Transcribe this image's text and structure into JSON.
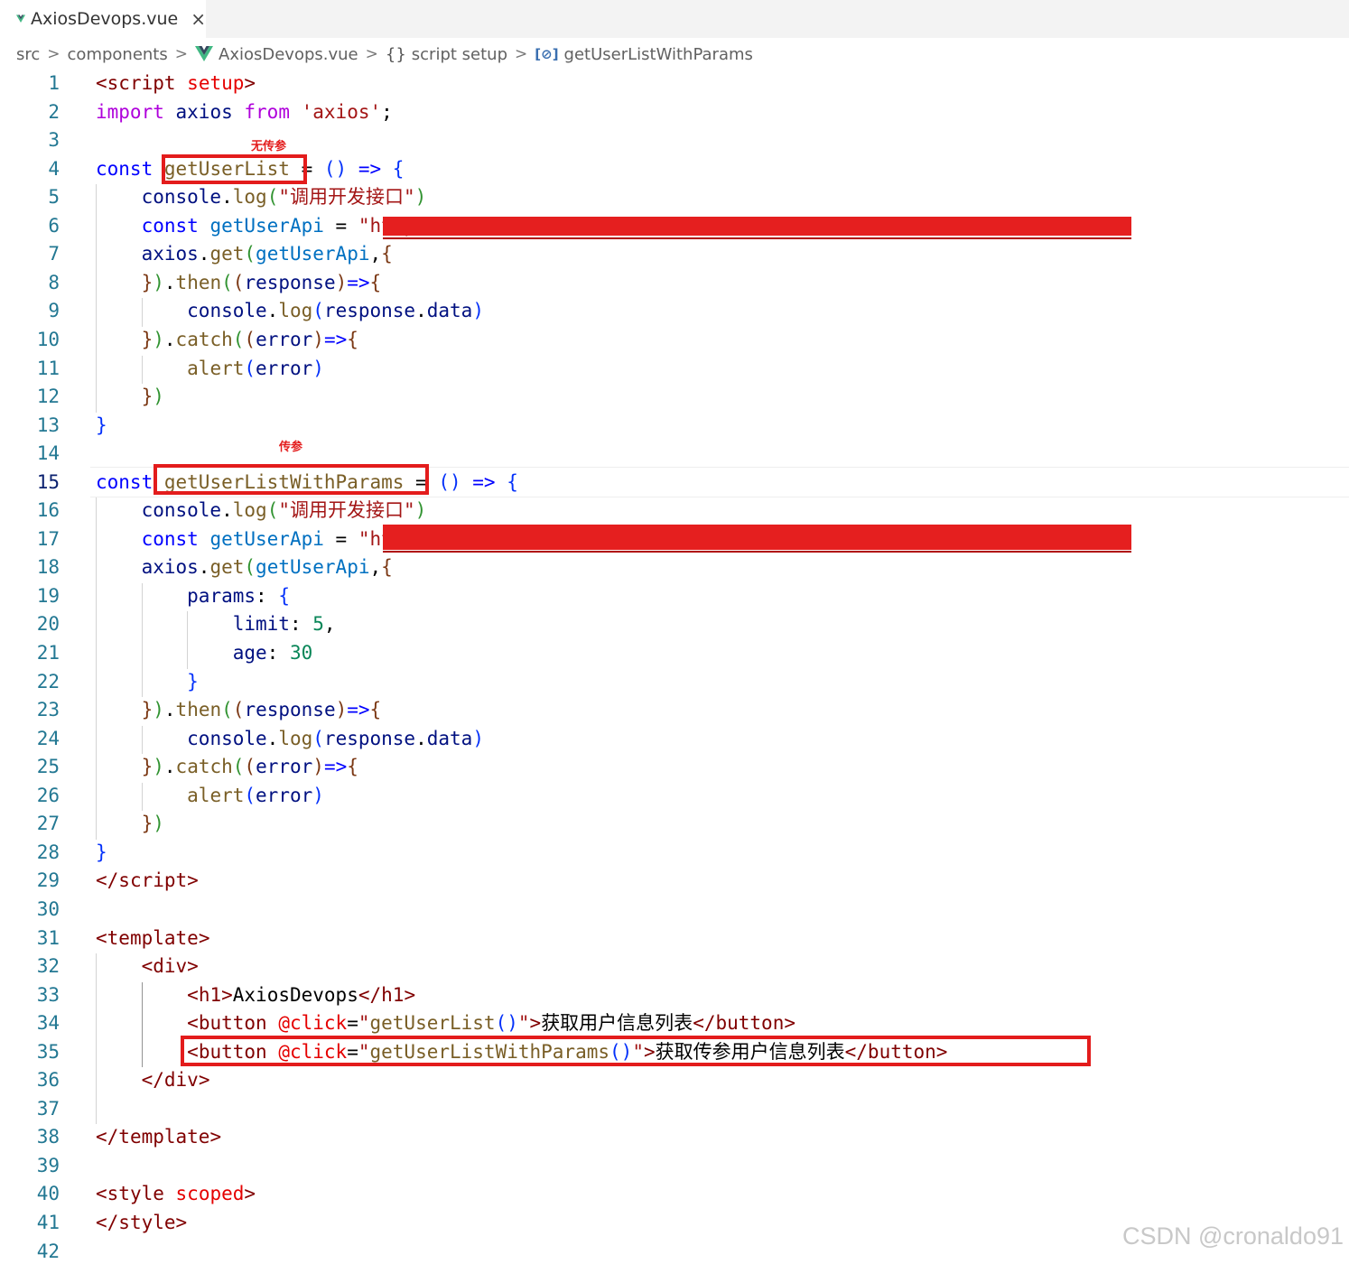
{
  "tab": {
    "title": "AxiosDevops.vue",
    "close_icon": "×"
  },
  "breadcrumb": {
    "src": "src",
    "components": "components",
    "file": "AxiosDevops.vue",
    "braces_icon": "{}",
    "section": "script setup",
    "var_icon": "[⊘]",
    "symbol": "getUserListWithParams",
    "sep": ">"
  },
  "annotations": {
    "no_params": "无传参",
    "with_params": "传参"
  },
  "editor": {
    "active_line": 15,
    "line_numbers": [
      "1",
      "2",
      "3",
      "4",
      "5",
      "6",
      "7",
      "8",
      "9",
      "10",
      "11",
      "12",
      "13",
      "14",
      "15",
      "16",
      "17",
      "18",
      "19",
      "20",
      "21",
      "22",
      "23",
      "24",
      "25",
      "26",
      "27",
      "28",
      "29",
      "30",
      "31",
      "32",
      "33",
      "34",
      "35",
      "36",
      "37",
      "38",
      "39",
      "40",
      "41",
      "42"
    ],
    "lines": [
      [
        [
          "ang",
          "<"
        ],
        [
          "tag",
          "script"
        ],
        [
          "pl",
          " "
        ],
        [
          "attr",
          "setup"
        ],
        [
          "ang",
          ">"
        ]
      ],
      [
        [
          "ctl",
          "import"
        ],
        [
          "pl",
          " "
        ],
        [
          "var",
          "axios"
        ],
        [
          "pl",
          " "
        ],
        [
          "ctl",
          "from"
        ],
        [
          "pl",
          " "
        ],
        [
          "str",
          "'axios'"
        ],
        [
          "pl",
          ";"
        ]
      ],
      [],
      [
        [
          "kw",
          "const"
        ],
        [
          "pl",
          " "
        ],
        [
          "fn",
          "getUserList"
        ],
        [
          "pl",
          " = "
        ],
        [
          "br1",
          "()"
        ],
        [
          "pl",
          " "
        ],
        [
          "kw",
          "=>"
        ],
        [
          "pl",
          " "
        ],
        [
          "br1",
          "{"
        ]
      ],
      [
        [
          "pl",
          "    "
        ],
        [
          "var",
          "console"
        ],
        [
          "pl",
          "."
        ],
        [
          "fn",
          "log"
        ],
        [
          "br2",
          "("
        ],
        [
          "str",
          "\"调用开发接口\""
        ],
        [
          "br2",
          ")"
        ]
      ],
      [
        [
          "pl",
          "    "
        ],
        [
          "kw",
          "const"
        ],
        [
          "pl",
          " "
        ],
        [
          "cst",
          "getUserApi"
        ],
        [
          "pl",
          " = "
        ],
        [
          "str",
          "\"https://xxxx.xxxx.xxxxxxxx.xxxxxx/xxxxxxx/xxxxxxx/xxxx\""
        ]
      ],
      [
        [
          "pl",
          "    "
        ],
        [
          "var",
          "axios"
        ],
        [
          "pl",
          "."
        ],
        [
          "fn",
          "get"
        ],
        [
          "br2",
          "("
        ],
        [
          "cst",
          "getUserApi"
        ],
        [
          "pl",
          ","
        ],
        [
          "br3",
          "{"
        ]
      ],
      [
        [
          "pl",
          "    "
        ],
        [
          "br3",
          "}"
        ],
        [
          "br2",
          ")"
        ],
        [
          "pl",
          "."
        ],
        [
          "fn",
          "then"
        ],
        [
          "br2",
          "("
        ],
        [
          "br3",
          "("
        ],
        [
          "var",
          "response"
        ],
        [
          "br3",
          ")"
        ],
        [
          "kw",
          "=>"
        ],
        [
          "br3",
          "{"
        ]
      ],
      [
        [
          "pl",
          "        "
        ],
        [
          "var",
          "console"
        ],
        [
          "pl",
          "."
        ],
        [
          "fn",
          "log"
        ],
        [
          "br1",
          "("
        ],
        [
          "var",
          "response"
        ],
        [
          "pl",
          "."
        ],
        [
          "var",
          "data"
        ],
        [
          "br1",
          ")"
        ]
      ],
      [
        [
          "pl",
          "    "
        ],
        [
          "br3",
          "}"
        ],
        [
          "br2",
          ")"
        ],
        [
          "pl",
          "."
        ],
        [
          "fn",
          "catch"
        ],
        [
          "br2",
          "("
        ],
        [
          "br3",
          "("
        ],
        [
          "var",
          "error"
        ],
        [
          "br3",
          ")"
        ],
        [
          "kw",
          "=>"
        ],
        [
          "br3",
          "{"
        ]
      ],
      [
        [
          "pl",
          "        "
        ],
        [
          "fn",
          "alert"
        ],
        [
          "br1",
          "("
        ],
        [
          "var",
          "error"
        ],
        [
          "br1",
          ")"
        ]
      ],
      [
        [
          "pl",
          "    "
        ],
        [
          "br3",
          "}"
        ],
        [
          "br2",
          ")"
        ]
      ],
      [
        [
          "br1",
          "}"
        ]
      ],
      [],
      [
        [
          "kw",
          "const"
        ],
        [
          "pl",
          " "
        ],
        [
          "fn",
          "getUserListWithParams"
        ],
        [
          "pl",
          " = "
        ],
        [
          "br1",
          "()"
        ],
        [
          "pl",
          " "
        ],
        [
          "kw",
          "=>"
        ],
        [
          "pl",
          " "
        ],
        [
          "br1",
          "{"
        ]
      ],
      [
        [
          "pl",
          "    "
        ],
        [
          "var",
          "console"
        ],
        [
          "pl",
          "."
        ],
        [
          "fn",
          "log"
        ],
        [
          "br2",
          "("
        ],
        [
          "str",
          "\"调用开发接口\""
        ],
        [
          "br2",
          ")"
        ]
      ],
      [
        [
          "pl",
          "    "
        ],
        [
          "kw",
          "const"
        ],
        [
          "pl",
          " "
        ],
        [
          "cst",
          "getUserApi"
        ],
        [
          "pl",
          " = "
        ],
        [
          "str",
          "\"https://xxxx.xxxx.xxxxxxxx.xxxxxx/xxxxxxx/xxxxxxx/xxxx\""
        ]
      ],
      [
        [
          "pl",
          "    "
        ],
        [
          "var",
          "axios"
        ],
        [
          "pl",
          "."
        ],
        [
          "fn",
          "get"
        ],
        [
          "br2",
          "("
        ],
        [
          "cst",
          "getUserApi"
        ],
        [
          "pl",
          ","
        ],
        [
          "br3",
          "{"
        ]
      ],
      [
        [
          "pl",
          "        "
        ],
        [
          "var",
          "params"
        ],
        [
          "pl",
          ": "
        ],
        [
          "br1",
          "{"
        ]
      ],
      [
        [
          "pl",
          "            "
        ],
        [
          "var",
          "limit"
        ],
        [
          "pl",
          ": "
        ],
        [
          "num",
          "5"
        ],
        [
          "pl",
          ","
        ]
      ],
      [
        [
          "pl",
          "            "
        ],
        [
          "var",
          "age"
        ],
        [
          "pl",
          ": "
        ],
        [
          "num",
          "30"
        ]
      ],
      [
        [
          "pl",
          "        "
        ],
        [
          "br1",
          "}"
        ]
      ],
      [
        [
          "pl",
          "    "
        ],
        [
          "br3",
          "}"
        ],
        [
          "br2",
          ")"
        ],
        [
          "pl",
          "."
        ],
        [
          "fn",
          "then"
        ],
        [
          "br2",
          "("
        ],
        [
          "br3",
          "("
        ],
        [
          "var",
          "response"
        ],
        [
          "br3",
          ")"
        ],
        [
          "kw",
          "=>"
        ],
        [
          "br3",
          "{"
        ]
      ],
      [
        [
          "pl",
          "        "
        ],
        [
          "var",
          "console"
        ],
        [
          "pl",
          "."
        ],
        [
          "fn",
          "log"
        ],
        [
          "br1",
          "("
        ],
        [
          "var",
          "response"
        ],
        [
          "pl",
          "."
        ],
        [
          "var",
          "data"
        ],
        [
          "br1",
          ")"
        ]
      ],
      [
        [
          "pl",
          "    "
        ],
        [
          "br3",
          "}"
        ],
        [
          "br2",
          ")"
        ],
        [
          "pl",
          "."
        ],
        [
          "fn",
          "catch"
        ],
        [
          "br2",
          "("
        ],
        [
          "br3",
          "("
        ],
        [
          "var",
          "error"
        ],
        [
          "br3",
          ")"
        ],
        [
          "kw",
          "=>"
        ],
        [
          "br3",
          "{"
        ]
      ],
      [
        [
          "pl",
          "        "
        ],
        [
          "fn",
          "alert"
        ],
        [
          "br1",
          "("
        ],
        [
          "var",
          "error"
        ],
        [
          "br1",
          ")"
        ]
      ],
      [
        [
          "pl",
          "    "
        ],
        [
          "br3",
          "}"
        ],
        [
          "br2",
          ")"
        ]
      ],
      [
        [
          "br1",
          "}"
        ]
      ],
      [
        [
          "ang",
          "</"
        ],
        [
          "tag",
          "script"
        ],
        [
          "ang",
          ">"
        ]
      ],
      [],
      [
        [
          "ang",
          "<"
        ],
        [
          "tag",
          "template"
        ],
        [
          "ang",
          ">"
        ]
      ],
      [
        [
          "pl",
          "    "
        ],
        [
          "ang",
          "<"
        ],
        [
          "tag",
          "div"
        ],
        [
          "ang",
          ">"
        ]
      ],
      [
        [
          "pl",
          "        "
        ],
        [
          "ang",
          "<"
        ],
        [
          "tag",
          "h1"
        ],
        [
          "ang",
          ">"
        ],
        [
          "pl",
          "AxiosDevops"
        ],
        [
          "ang",
          "</"
        ],
        [
          "tag",
          "h1"
        ],
        [
          "ang",
          ">"
        ]
      ],
      [
        [
          "pl",
          "        "
        ],
        [
          "ang",
          "<"
        ],
        [
          "tag",
          "button"
        ],
        [
          "pl",
          " "
        ],
        [
          "attr",
          "@click"
        ],
        [
          "pl",
          "="
        ],
        [
          "str",
          "\""
        ],
        [
          "fn",
          "getUserList"
        ],
        [
          "br1",
          "()"
        ],
        [
          "str",
          "\""
        ],
        [
          "ang",
          ">"
        ],
        [
          "pl",
          "获取用户信息列表"
        ],
        [
          "ang",
          "</"
        ],
        [
          "tag",
          "button"
        ],
        [
          "ang",
          ">"
        ]
      ],
      [
        [
          "pl",
          "        "
        ],
        [
          "ang",
          "<"
        ],
        [
          "tag",
          "button"
        ],
        [
          "pl",
          " "
        ],
        [
          "attr",
          "@click"
        ],
        [
          "pl",
          "="
        ],
        [
          "str",
          "\""
        ],
        [
          "fn",
          "getUserListWithParams"
        ],
        [
          "br1",
          "()"
        ],
        [
          "str",
          "\""
        ],
        [
          "ang",
          ">"
        ],
        [
          "pl",
          "获取传参用户信息列表"
        ],
        [
          "ang",
          "</"
        ],
        [
          "tag",
          "button"
        ],
        [
          "ang",
          ">"
        ]
      ],
      [
        [
          "pl",
          "    "
        ],
        [
          "ang",
          "</"
        ],
        [
          "tag",
          "div"
        ],
        [
          "ang",
          ">"
        ]
      ],
      [],
      [
        [
          "ang",
          "</"
        ],
        [
          "tag",
          "template"
        ],
        [
          "ang",
          ">"
        ]
      ],
      [],
      [
        [
          "ang",
          "<"
        ],
        [
          "tag",
          "style"
        ],
        [
          "pl",
          " "
        ],
        [
          "attr",
          "scoped"
        ],
        [
          "ang",
          ">"
        ]
      ],
      [
        [
          "ang",
          "</"
        ],
        [
          "tag",
          "style"
        ],
        [
          "ang",
          ">"
        ]
      ],
      []
    ]
  },
  "watermark": "CSDN @cronaldo91",
  "colors": {
    "annotation_red": "#e31c1c",
    "line_number": "#237893",
    "vue_green": "#41b883"
  }
}
